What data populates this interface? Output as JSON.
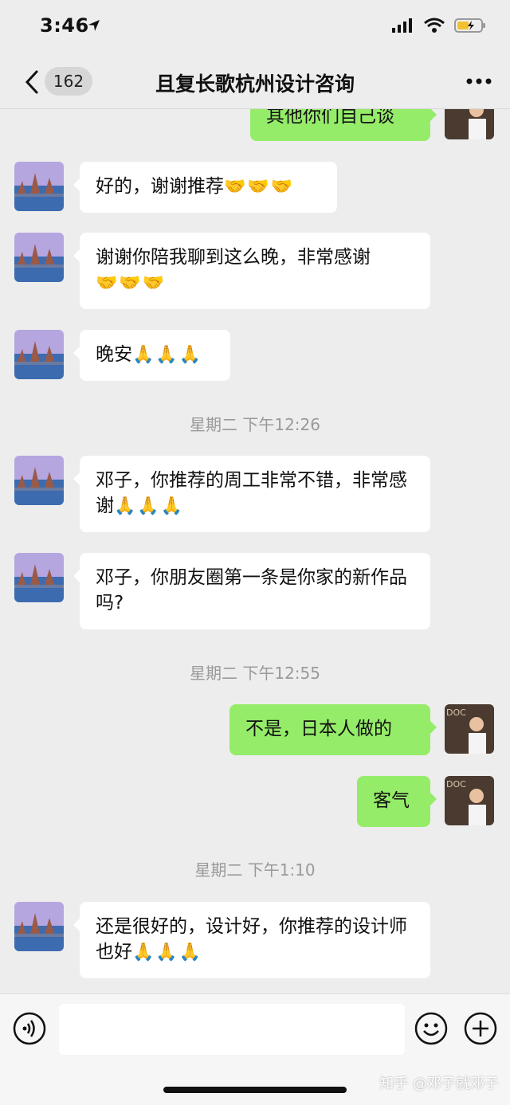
{
  "status": {
    "time": "3:46"
  },
  "header": {
    "back_count": "162",
    "title": "且复长歌杭州设计咨询"
  },
  "messages": [
    {
      "side": "out",
      "text": "其他你们自己谈"
    },
    {
      "side": "in",
      "text": "好的，谢谢推荐",
      "emoji": "🤝🤝🤝"
    },
    {
      "side": "in",
      "text": "谢谢你陪我聊到这么晚，非常感谢",
      "emoji": "🤝🤝🤝"
    },
    {
      "side": "in",
      "text": "晚安",
      "emoji": "🙏🙏🙏"
    },
    {
      "timestamp": "星期二 下午12:26"
    },
    {
      "side": "in",
      "text": "邓子，你推荐的周工非常不错，非常感谢",
      "emoji": "🙏🙏🙏"
    },
    {
      "side": "in",
      "text": "邓子，你朋友圈第一条是你家的新作品吗?"
    },
    {
      "timestamp": "星期二 下午12:55"
    },
    {
      "side": "out",
      "text": "不是，日本人做的"
    },
    {
      "side": "out",
      "text": "客气"
    },
    {
      "timestamp": "星期二 下午1:10"
    },
    {
      "side": "in",
      "text": "还是很好的，设计好，你推荐的设计师也好",
      "emoji": "🙏🙏🙏"
    }
  ],
  "input": {
    "value": ""
  },
  "watermark": "知乎 @邓子就邓子",
  "colors": {
    "background": "#ededed",
    "out_bubble": "#95ec69",
    "in_bubble": "#ffffff"
  }
}
